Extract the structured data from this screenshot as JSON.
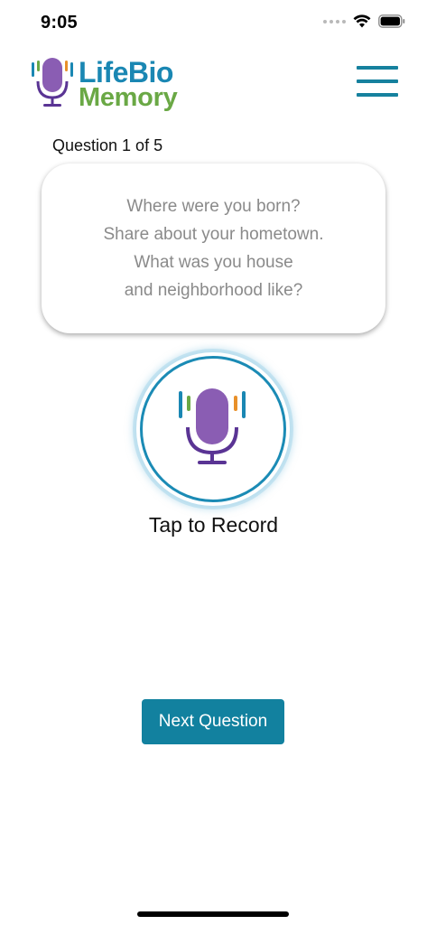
{
  "status_bar": {
    "time": "9:05",
    "icons": [
      "signal-icon",
      "wifi-icon",
      "battery-icon"
    ]
  },
  "header": {
    "logo_line1": "LifeBio",
    "logo_line2": "Memory",
    "menu_icon": "hamburger-menu-icon"
  },
  "question": {
    "counter": "Question 1 of 5",
    "text": "Where were you born?\nShare about your hometown.\nWhat was you house\nand neighborhood like?"
  },
  "record": {
    "icon": "microphone-icon",
    "label": "Tap to Record"
  },
  "actions": {
    "next_label": "Next Question"
  },
  "colors": {
    "brand_blue": "#1a87b3",
    "brand_green": "#6aa845",
    "mic_purple": "#8a5db3",
    "button_teal": "#12819f"
  }
}
